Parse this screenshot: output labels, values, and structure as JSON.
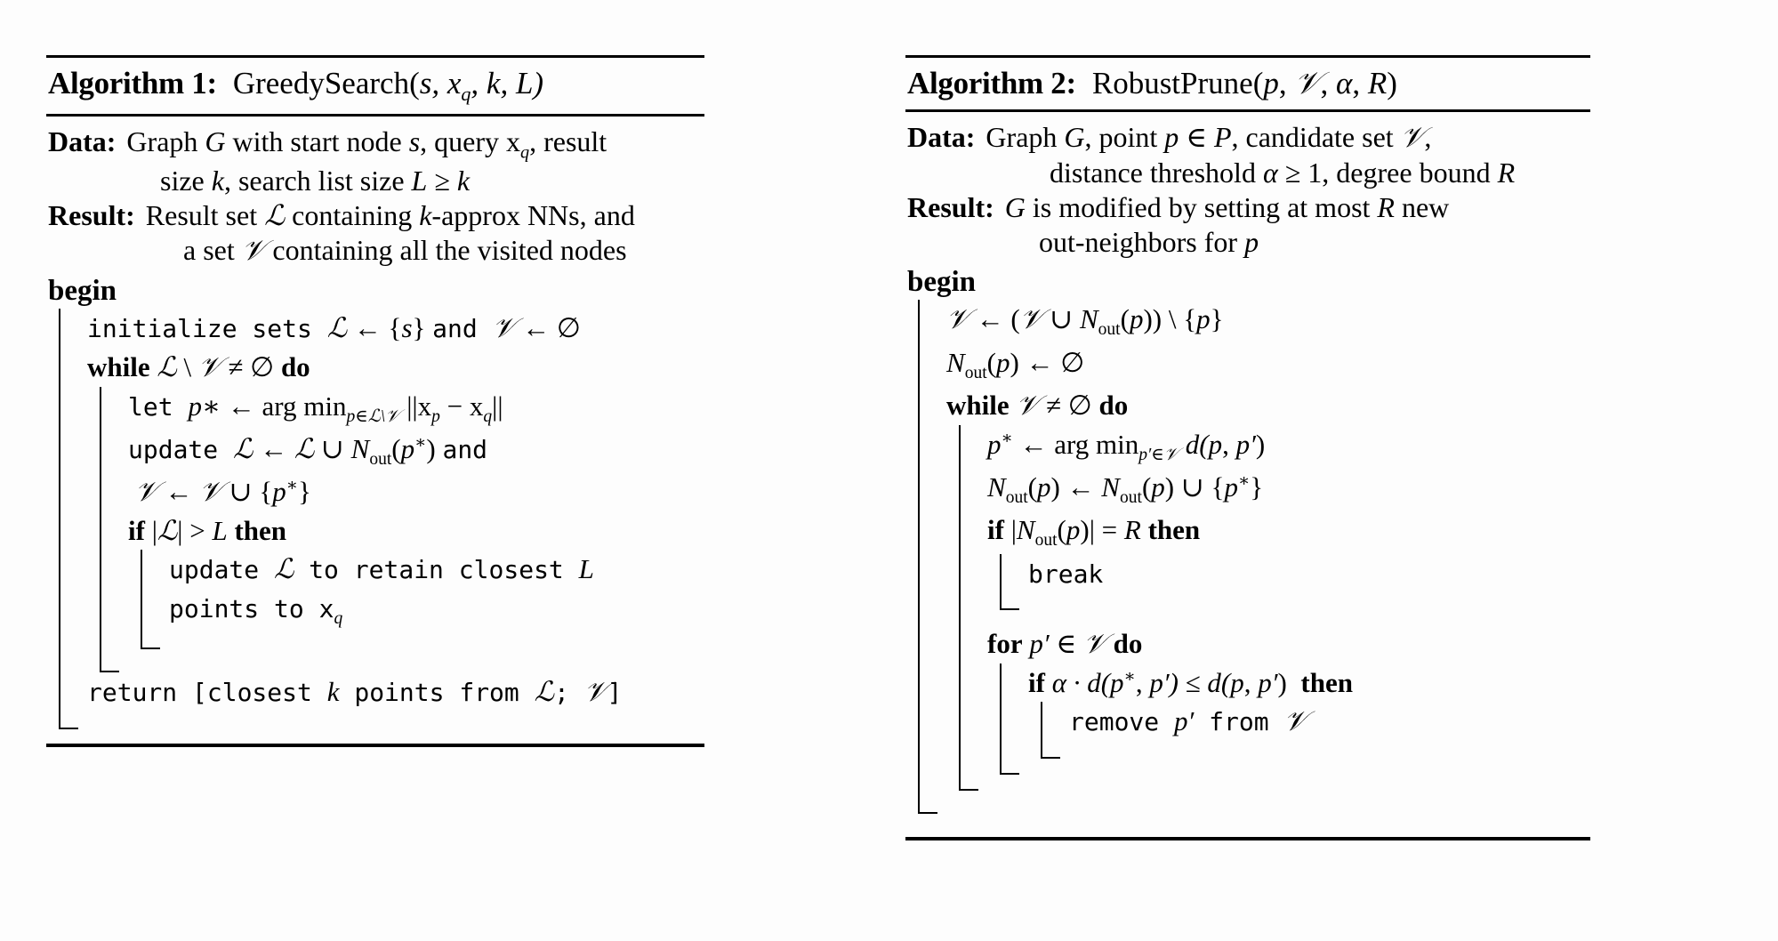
{
  "document": {
    "type": "algorithm-pseudocode-figure",
    "background_color": "#fdfdfd",
    "text_color": "#000000"
  },
  "algorithms": [
    {
      "id": "algorithm-1",
      "number_label": "Algorithm 1:",
      "name": "GreedySearch(s, x_q, k, L)",
      "data_key": "Data:",
      "data_lines": [
        "Graph G with start node s, query x_q, result",
        "size k, search list size L ≥ k"
      ],
      "result_key": "Result:",
      "result_lines": [
        "Result set ℒ containing k-approx NNs, and",
        "a set 𝒱 containing all the visited nodes"
      ],
      "begin": "begin",
      "lines": [
        "initialize sets ℒ ← {s} and 𝒱 ← ∅",
        "while ℒ \\ 𝒱 ≠ ∅ do",
        "let p* ← arg min_{p∈ℒ\\𝒱} ||x_p − x_q||",
        "update ℒ ← ℒ ∪ N_out(p*) and",
        "𝒱 ← 𝒱 ∪ {p*}",
        "if |ℒ| > L then",
        "update ℒ to retain closest L",
        "points to x_q",
        "return [closest k points from ℒ; 𝒱]"
      ]
    },
    {
      "id": "algorithm-2",
      "number_label": "Algorithm 2:",
      "name": "RobustPrune(p, 𝒱, α, R)",
      "data_key": "Data:",
      "data_lines": [
        "Graph G, point p ∈ P, candidate set 𝒱,",
        "distance threshold α ≥ 1, degree bound R"
      ],
      "result_key": "Result:",
      "result_lines": [
        "G is modified by setting at most R new",
        "out-neighbors for p"
      ],
      "begin": "begin",
      "lines": [
        "𝒱 ← (𝒱 ∪ N_out(p)) \\ {p}",
        "N_out(p) ← ∅",
        "while 𝒱 ≠ ∅ do",
        "p* ← arg min_{p'∈𝒱} d(p, p')",
        "N_out(p) ← N_out(p) ∪ {p*}",
        "if |N_out(p)| = R then",
        "break",
        "for p' ∈ 𝒱 do",
        "if α · d(p*, p') ≤ d(p, p') then",
        "remove p' from 𝒱"
      ]
    }
  ],
  "a1": {
    "title_label": "Algorithm 1:",
    "title_name_pre": "GreedySearch(",
    "title_args": "s, x",
    "title_sub": "q",
    "title_post": ", k, L)",
    "data_key": "Data:",
    "data_l1_a": "Graph ",
    "data_l1_G": "G",
    "data_l1_b": " with start node ",
    "data_l1_s": "s",
    "data_l1_c": ", query x",
    "data_l1_q": "q",
    "data_l1_d": ", result",
    "data_l2_a": "size ",
    "data_l2_k": "k",
    "data_l2_b": ", search list size ",
    "data_l2_L": "L",
    "data_l2_c": " ≥ ",
    "data_l2_k2": "k",
    "result_key": "Result:",
    "res_l1_a": "Result set ",
    "res_l1_L": "ℒ",
    "res_l1_b": " containing ",
    "res_l1_k": "k",
    "res_l1_c": "-approx NNs, and",
    "res_l2_a": "a set ",
    "res_l2_V": "𝒱",
    "res_l2_b": " containing all the visited nodes",
    "begin": "begin",
    "ln1_a": "initialize sets ",
    "ln1_L": "ℒ",
    "ln1_b": " ← {",
    "ln1_s": "s",
    "ln1_c": "} ",
    "ln1_and": "and ",
    "ln1_V": "𝒱",
    "ln1_d": " ← ∅",
    "ln2_while": "while",
    "ln2_L": "ℒ",
    "ln2_a": " \\ ",
    "ln2_V": "𝒱",
    "ln2_b": " ≠ ∅ ",
    "ln2_do": "do",
    "ln3_let": "let ",
    "ln3_p": "p",
    "ln3_star": "∗",
    "ln3_a": " ← arg min",
    "ln3_sub": "p∈ℒ\\𝒱",
    "ln3_b": " ||x",
    "ln3_sub2": "p",
    "ln3_c": " − x",
    "ln3_sub3": "q",
    "ln3_d": "||",
    "ln4_upd": "update ",
    "ln4_L": "ℒ",
    "ln4_a": " ← ",
    "ln4_L2": "ℒ",
    "ln4_b": " ∪ ",
    "ln4_N": "N",
    "ln4_sub": "out",
    "ln4_c": "(",
    "ln4_p": "p",
    "ln4_star": "∗",
    "ln4_d": ") ",
    "ln4_and": "and",
    "ln5_V": "𝒱",
    "ln5_a": " ← ",
    "ln5_V2": "𝒱",
    "ln5_b": " ∪ {",
    "ln5_p": "p",
    "ln5_star": "∗",
    "ln5_c": "}",
    "ln6_if": "if",
    "ln6_a": " |",
    "ln6_L": "ℒ",
    "ln6_b": "| > ",
    "ln6_Lk": "L",
    "ln6_then": "then",
    "ln7_a": "update ",
    "ln7_L": "ℒ",
    "ln7_b": " to retain closest ",
    "ln7_Lk": "L",
    "ln8_a": "points to x",
    "ln8_q": "q",
    "ln9_ret": "return [closest ",
    "ln9_k": "k",
    "ln9_a": " points from ",
    "ln9_L": "ℒ",
    "ln9_b": "; ",
    "ln9_V": "𝒱",
    "ln9_c": "]"
  },
  "a2": {
    "title_label": "Algorithm 2:",
    "title_name_pre": "RobustPrune(",
    "title_p": "p",
    "title_a": ", ",
    "title_V": "𝒱",
    "title_b": ", ",
    "title_alpha": "α",
    "title_c": ", ",
    "title_R": "R",
    "title_d": ")",
    "data_key": "Data:",
    "data_l1_a": "Graph ",
    "data_l1_G": "G",
    "data_l1_b": ", point ",
    "data_l1_p": "p",
    "data_l1_c": " ∈ ",
    "data_l1_P": "P",
    "data_l1_d": ", candidate set ",
    "data_l1_V": "𝒱",
    "data_l1_e": ",",
    "data_l2_a": "distance threshold ",
    "data_l2_alpha": "α",
    "data_l2_b": " ≥ 1, degree bound ",
    "data_l2_R": "R",
    "result_key": "Result:",
    "res_l1_G": "G",
    "res_l1_a": " is modified by setting at most ",
    "res_l1_R": "R",
    "res_l1_b": " new",
    "res_l2_a": "out-neighbors for ",
    "res_l2_p": "p",
    "begin": "begin",
    "ln1_V": "𝒱",
    "ln1_a": " ← (",
    "ln1_V2": "𝒱",
    "ln1_b": " ∪ ",
    "ln1_N": "N",
    "ln1_sub": "out",
    "ln1_c": "(",
    "ln1_p": "p",
    "ln1_d": ")) \\ {",
    "ln1_p2": "p",
    "ln1_e": "}",
    "ln2_N": "N",
    "ln2_sub": "out",
    "ln2_a": "(",
    "ln2_p": "p",
    "ln2_b": ") ← ∅",
    "ln3_while": "while",
    "ln3_V": "𝒱",
    "ln3_a": " ≠ ∅ ",
    "ln3_do": "do",
    "ln4_p": "p",
    "ln4_star": "∗",
    "ln4_a": " ← arg min",
    "ln4_sub": "p′∈𝒱",
    "ln4_b": " d(",
    "ln4_p2": "p",
    "ln4_c": ", ",
    "ln4_p3": "p′",
    "ln4_d": ")",
    "ln5_N": "N",
    "ln5_sub": "out",
    "ln5_a": "(",
    "ln5_p": "p",
    "ln5_b": ") ← ",
    "ln5_N2": "N",
    "ln5_sub2": "out",
    "ln5_c": "(",
    "ln5_p2": "p",
    "ln5_d": ") ∪ {",
    "ln5_p3": "p",
    "ln5_star": "∗",
    "ln5_e": "}",
    "ln6_if": "if",
    "ln6_a": " |",
    "ln6_N": "N",
    "ln6_sub": "out",
    "ln6_b": "(",
    "ln6_p": "p",
    "ln6_c": ")| = ",
    "ln6_R": "R",
    "ln6_then": "then",
    "ln7_break": "break",
    "ln8_for": "for",
    "ln8_p": "p′",
    "ln8_a": " ∈ ",
    "ln8_V": "𝒱",
    "ln8_do": "do",
    "ln9_if": "if",
    "ln9_alpha": " α",
    "ln9_a": " · d(",
    "ln9_p": "p",
    "ln9_star": "∗",
    "ln9_b": ", ",
    "ln9_p2": "p′",
    "ln9_c": ") ≤ d(",
    "ln9_p3": "p",
    "ln9_d": ", ",
    "ln9_p4": "p′",
    "ln9_e": ") ",
    "ln9_then": "then",
    "ln10_rem": "remove ",
    "ln10_p": "p′",
    "ln10_a": " from ",
    "ln10_V": "𝒱"
  }
}
